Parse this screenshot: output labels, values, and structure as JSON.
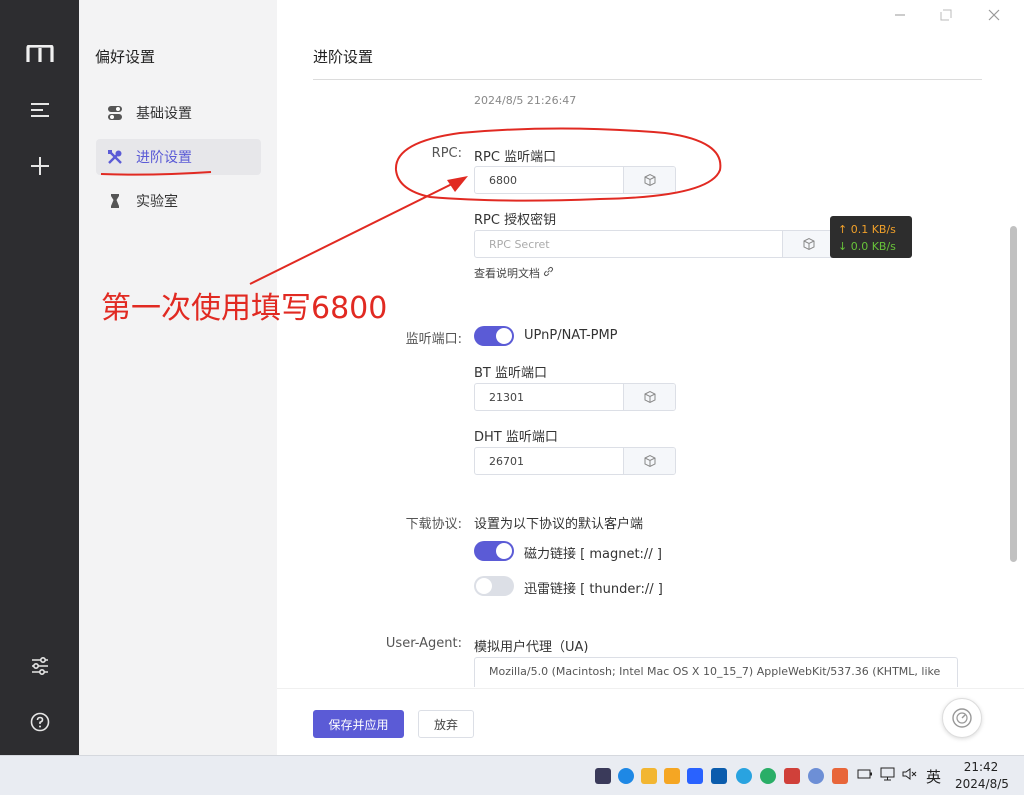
{
  "nav": {
    "title": "偏好设置",
    "items": [
      {
        "label": "基础设置"
      },
      {
        "label": "进阶设置"
      },
      {
        "label": "实验室"
      }
    ]
  },
  "main": {
    "title": "进阶设置",
    "timestamp": "2024/8/5 21:26:47",
    "rpc": {
      "row_label": "RPC:",
      "port_label": "RPC 监听端口",
      "port_value": "6800",
      "secret_label": "RPC 授权密钥",
      "secret_placeholder": "RPC Secret",
      "doc_link": "查看说明文档"
    },
    "listen": {
      "row_label": "监听端口:",
      "upnp_label": "UPnP/NAT-PMP",
      "upnp_on": true,
      "bt_label": "BT 监听端口",
      "bt_value": "21301",
      "dht_label": "DHT 监听端口",
      "dht_value": "26701"
    },
    "protocol": {
      "row_label": "下载协议:",
      "description": "设置为以下协议的默认客户端",
      "magnet_label": "磁力链接 [ magnet:// ]",
      "magnet_on": true,
      "thunder_label": "迅雷链接 [ thunder:// ]",
      "thunder_on": false
    },
    "ua": {
      "row_label": "User-Agent:",
      "label": "模拟用户代理（UA)",
      "value": "Mozilla/5.0 (Macintosh; Intel Mac OS X 10_15_7) AppleWebKit/537.36 (KHTML, like"
    },
    "buttons": {
      "save": "保存并应用",
      "discard": "放弃"
    }
  },
  "speed": {
    "upload": "↑ 0.1 KB/s",
    "download": "↓ 0.0 KB/s"
  },
  "annotation": {
    "text": "第一次使用填写6800"
  },
  "taskbar": {
    "ime": "英",
    "time": "21:42",
    "date": "2024/8/5"
  },
  "colors": {
    "accent": "#5b5bd6",
    "annotation": "#e12a22",
    "rail": "#2d2d30",
    "upload": "#f0a02a",
    "download": "#67c23a"
  }
}
